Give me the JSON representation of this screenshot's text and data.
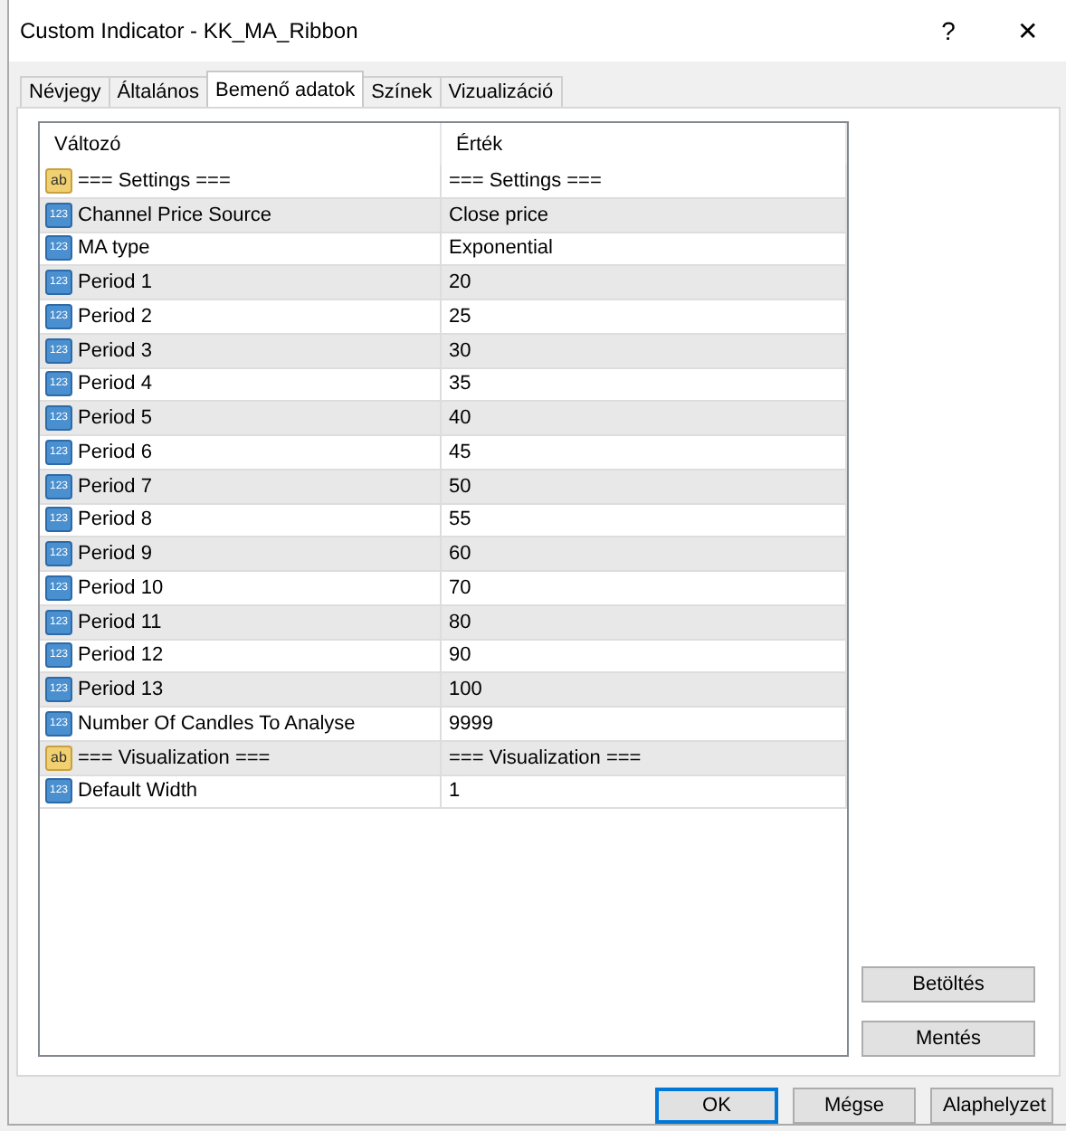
{
  "window": {
    "title": "Custom Indicator - KK_MA_Ribbon",
    "help": "?",
    "close": "✕"
  },
  "tabs": [
    {
      "label": "Névjegy",
      "selected": false
    },
    {
      "label": "Általános",
      "selected": false
    },
    {
      "label": "Bemenő adatok",
      "selected": true
    },
    {
      "label": "Színek",
      "selected": false
    },
    {
      "label": "Vizualizáció",
      "selected": false
    }
  ],
  "table": {
    "columns": [
      "Változó",
      "Érték"
    ],
    "rows": [
      {
        "kind": "text",
        "badge": "ab",
        "name": "=== Settings ===",
        "value": "=== Settings ==="
      },
      {
        "kind": "number",
        "badge": "123",
        "name": "Channel Price Source",
        "value": "Close price"
      },
      {
        "kind": "number",
        "badge": "123",
        "name": "MA type",
        "value": "Exponential"
      },
      {
        "kind": "number",
        "badge": "123",
        "name": "Period 1",
        "value": "20"
      },
      {
        "kind": "number",
        "badge": "123",
        "name": "Period 2",
        "value": "25"
      },
      {
        "kind": "number",
        "badge": "123",
        "name": "Period 3",
        "value": "30"
      },
      {
        "kind": "number",
        "badge": "123",
        "name": "Period 4",
        "value": "35"
      },
      {
        "kind": "number",
        "badge": "123",
        "name": "Period 5",
        "value": "40"
      },
      {
        "kind": "number",
        "badge": "123",
        "name": "Period 6",
        "value": "45"
      },
      {
        "kind": "number",
        "badge": "123",
        "name": "Period 7",
        "value": "50"
      },
      {
        "kind": "number",
        "badge": "123",
        "name": "Period 8",
        "value": "55"
      },
      {
        "kind": "number",
        "badge": "123",
        "name": "Period 9",
        "value": "60"
      },
      {
        "kind": "number",
        "badge": "123",
        "name": "Period 10",
        "value": "70"
      },
      {
        "kind": "number",
        "badge": "123",
        "name": "Period 11",
        "value": "80"
      },
      {
        "kind": "number",
        "badge": "123",
        "name": "Period 12",
        "value": "90"
      },
      {
        "kind": "number",
        "badge": "123",
        "name": "Period 13",
        "value": "100"
      },
      {
        "kind": "number",
        "badge": "123",
        "name": "Number Of Candles To Analyse",
        "value": "9999"
      },
      {
        "kind": "text",
        "badge": "ab",
        "name": "=== Visualization ===",
        "value": "=== Visualization ==="
      },
      {
        "kind": "number",
        "badge": "123",
        "name": "Default Width",
        "value": "1"
      }
    ]
  },
  "side_buttons": [
    "Betöltés",
    "Mentés"
  ],
  "buttons": [
    {
      "label": "OK",
      "selected": true
    },
    {
      "label": "Mégse",
      "selected": false
    },
    {
      "label": "Alaphelyzet",
      "selected": false
    }
  ]
}
